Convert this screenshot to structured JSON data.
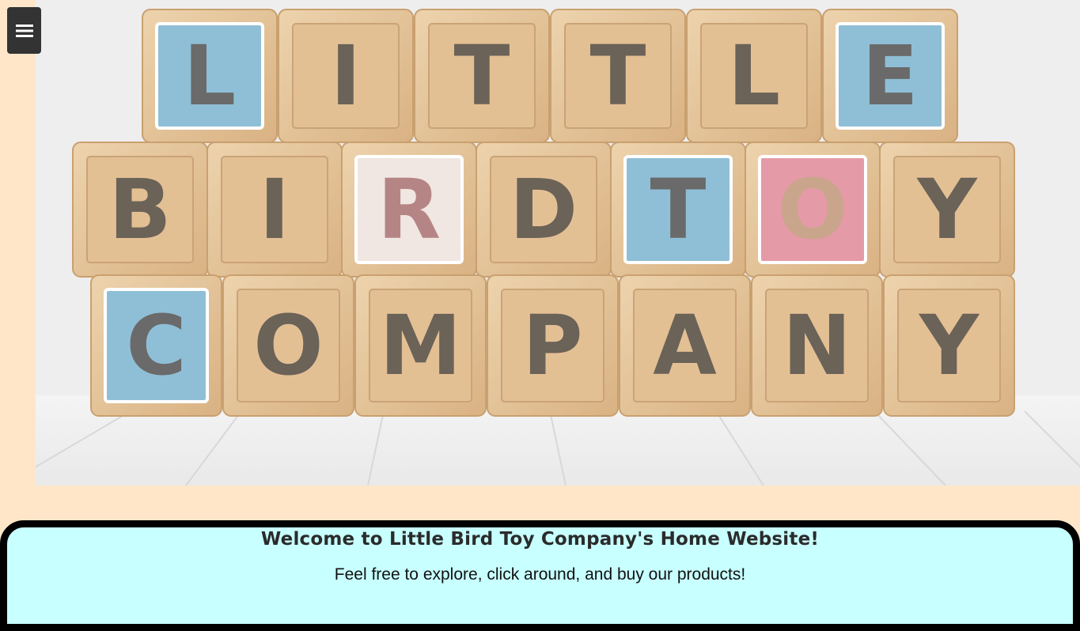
{
  "menu": {
    "icon": "hamburger-menu-icon"
  },
  "hero": {
    "rows": [
      {
        "letters": [
          "L",
          "I",
          "T",
          "T",
          "L",
          "E"
        ]
      },
      {
        "letters": [
          "B",
          "I",
          "R",
          "D",
          "T",
          "O",
          "Y"
        ]
      },
      {
        "letters": [
          "C",
          "O",
          "M",
          "P",
          "A",
          "N",
          "Y"
        ]
      }
    ],
    "colors": {
      "wood": "#e8c9a0",
      "wood_dark": "#c9a070",
      "blue": "#8fbfd6",
      "pink": "#e59aa8",
      "white_block": "#f0e6e2",
      "letter": "#6b6258",
      "floor": "#f3f3f3"
    }
  },
  "welcome": {
    "title": "Welcome to Little Bird Toy Company's Home Website!",
    "subtitle": "Feel free to explore, click around, and buy our products!"
  }
}
